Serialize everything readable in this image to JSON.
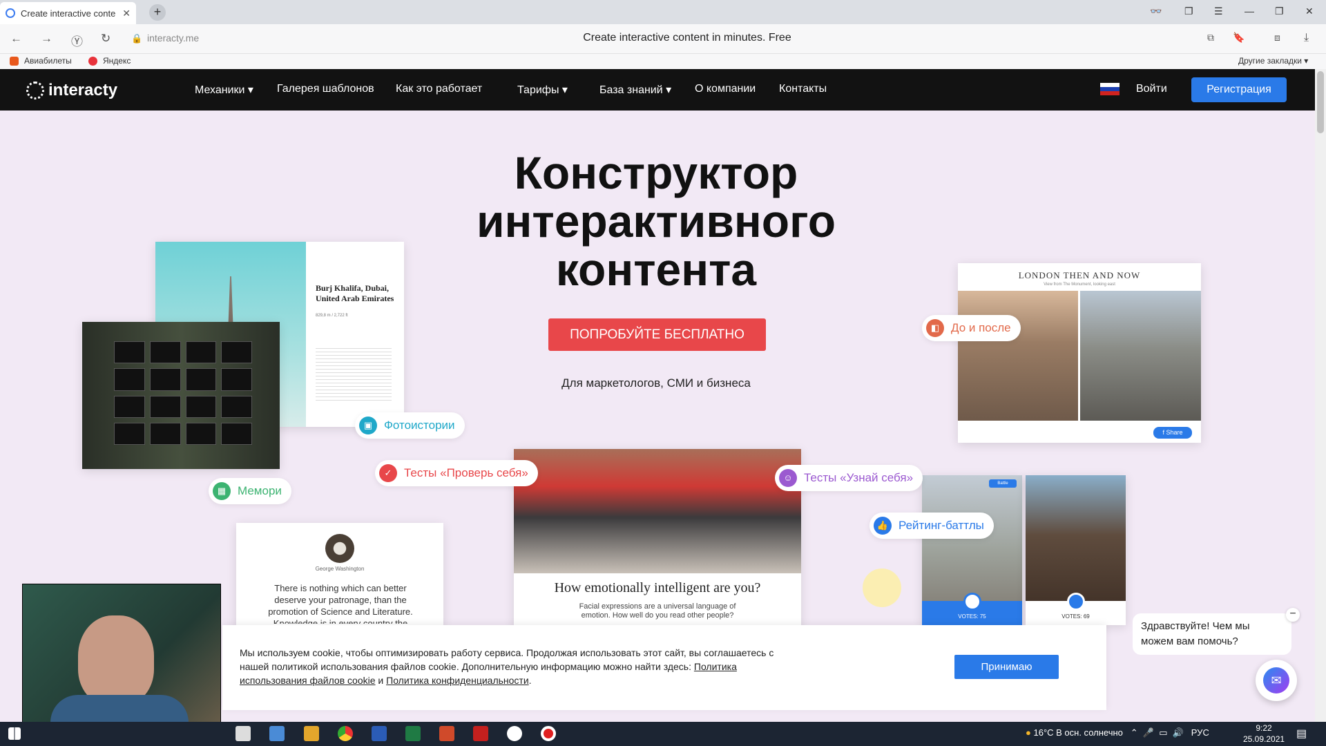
{
  "browser": {
    "tab_title": "Create interactive conte",
    "url": "interacty.me",
    "page_title": "Create interactive content in minutes. Free",
    "bookmarks": [
      {
        "label": "Авиабилеты"
      },
      {
        "label": "Яндекс"
      }
    ],
    "other_bookmarks": "Другие закладки"
  },
  "site": {
    "logo": "interacty",
    "nav": [
      {
        "label": "Механики",
        "dropdown": true
      },
      {
        "label": "Галерея шаблонов",
        "dropdown": false
      },
      {
        "label": "Как это работает",
        "dropdown": false
      },
      {
        "label": "Тарифы",
        "dropdown": true
      },
      {
        "label": "База знаний",
        "dropdown": true
      },
      {
        "label": "О компании",
        "dropdown": false
      },
      {
        "label": "Контакты",
        "dropdown": false
      }
    ],
    "login": "Войти",
    "register": "Регистрация"
  },
  "hero": {
    "title_lines": [
      "Конструктор",
      "интерактивного",
      "контента"
    ],
    "cta": "ПОПРОБУЙТЕ БЕСПЛАТНО",
    "subtitle": "Для маркетологов, СМИ и бизнеса"
  },
  "mechanics": [
    {
      "label": "Фотоистории",
      "color": "#1fa8c9"
    },
    {
      "label": "Тесты «Проверь себя»",
      "color": "#e8474a"
    },
    {
      "label": "Мемори",
      "color": "#3cb371"
    },
    {
      "label": "До и после",
      "color": "#e2694a"
    },
    {
      "label": "Тесты «Узнай себя»",
      "color": "#9b59d0"
    },
    {
      "label": "Рейтинг-баттлы",
      "color": "#2a7ae8"
    }
  ],
  "cards": {
    "burj": {
      "title": "Burj Khalifa, Dubai, United Arab Emirates",
      "meta": "829,8 m / 2,722 ft"
    },
    "london": {
      "title": "London Then And Now",
      "subtitle": "View from The Monument, looking east",
      "share": "Share"
    },
    "quote": {
      "author": "George Washington",
      "text": "There is nothing which can better deserve your patronage, than the promotion of Science and Literature. Knowledge is in every country the"
    },
    "quiz": {
      "title": "How emotionally intelligent are you?",
      "desc": "Facial expressions are a universal language of emotion. How well do you read other people?"
    },
    "battle": {
      "votes_cat": "VOTES: 75",
      "votes_dog": "VOTES: 69",
      "badge": "Battle"
    }
  },
  "cookie": {
    "text": "Мы используем cookie, чтобы оптимизировать работу сервиса. Продолжая использовать этот сайт, вы соглашаетесь с нашей политикой использования файлов cookie. Дополнительную информацию можно найти здесь:",
    "link1": "Политика использования файлов cookie",
    "and": "и",
    "link2": "Политика конфиденциальности",
    "accept": "Принимаю"
  },
  "chat": {
    "greeting": "Здравствуйте! Чем мы можем вам помочь?"
  },
  "taskbar": {
    "weather": "16°C  В осн. солнечно",
    "lang": "РУС",
    "time": "9:22",
    "date": "25.09.2021"
  },
  "colors": {
    "accent": "#2a7ae8",
    "cta": "#e8474a",
    "nav_bg": "#121212",
    "page_bg": "#f2e9f5"
  }
}
